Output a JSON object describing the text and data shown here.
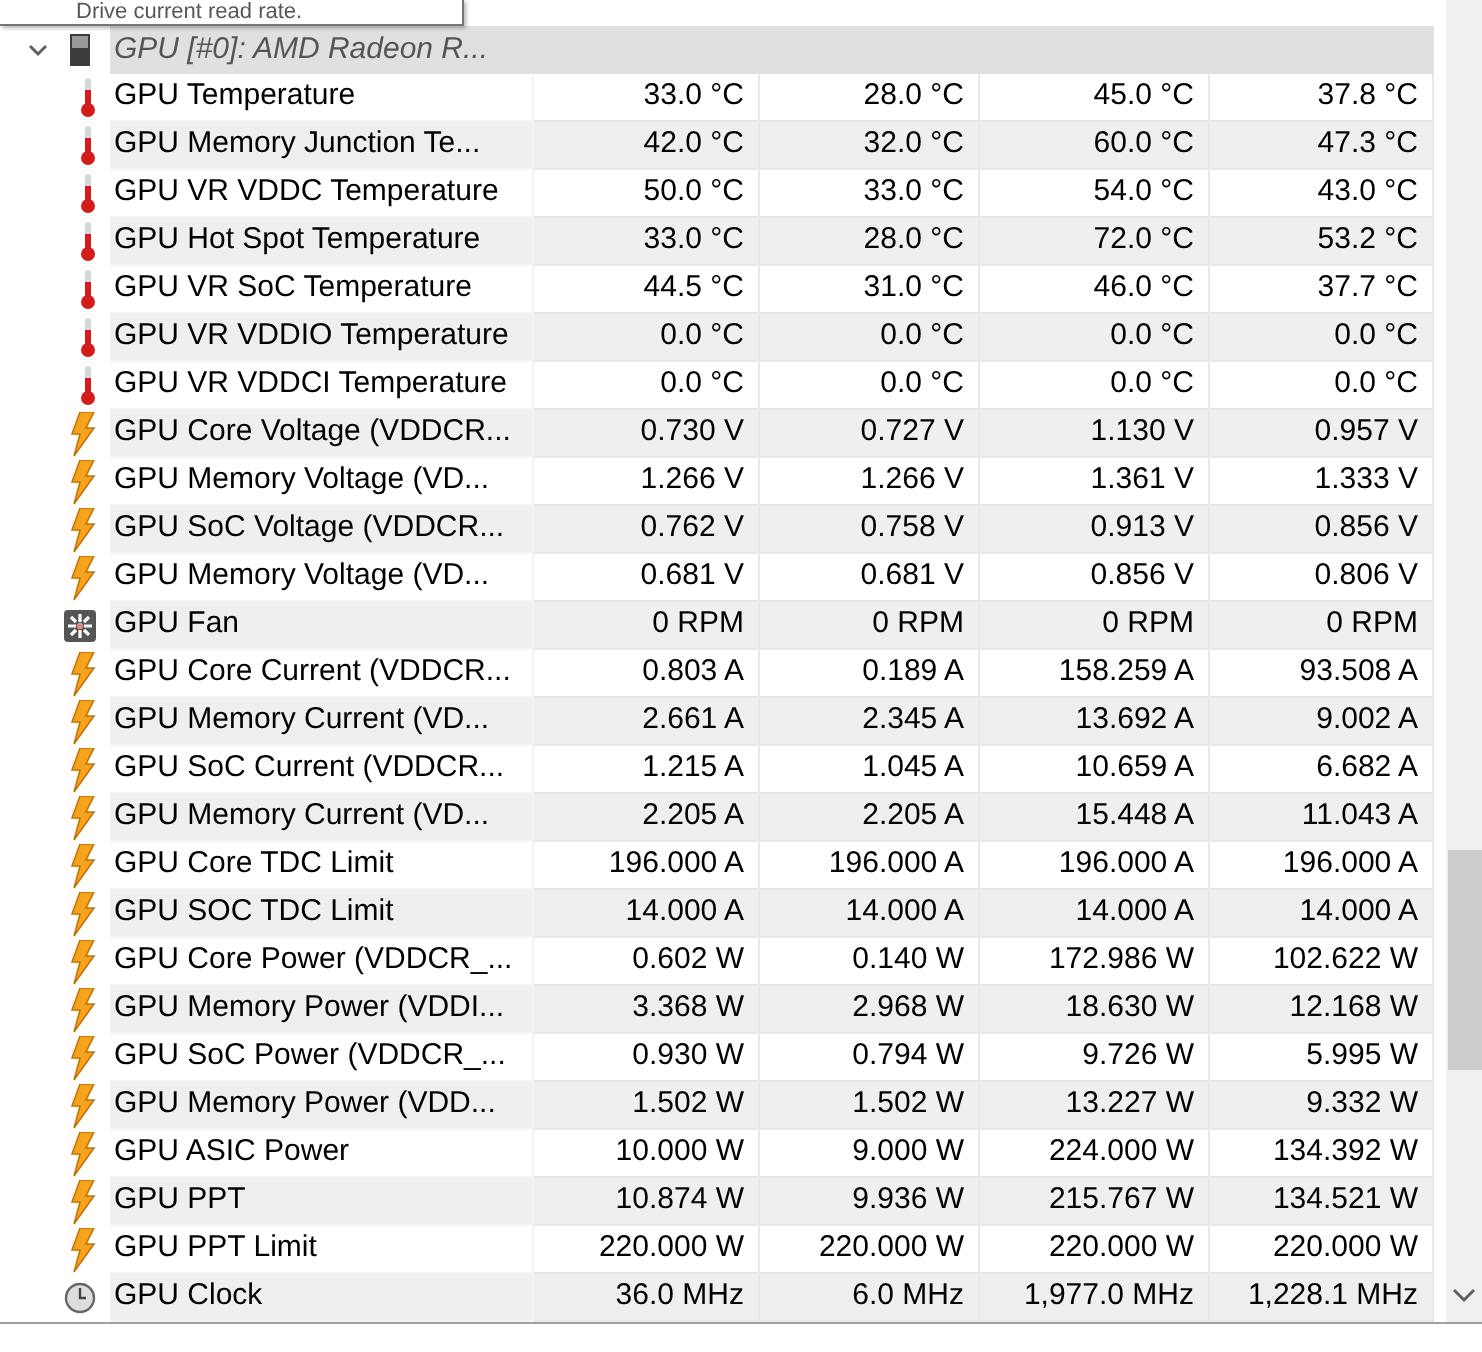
{
  "tooltip": "Drive current read rate.",
  "group": {
    "label": "GPU [#0]: AMD Radeon R...",
    "expanded": true
  },
  "rows": [
    {
      "kind": "temperature",
      "name": "GPU Temperature",
      "values": [
        "33.0 °C",
        "28.0 °C",
        "45.0 °C",
        "37.8 °C"
      ]
    },
    {
      "kind": "temperature",
      "name": "GPU Memory Junction Te...",
      "values": [
        "42.0 °C",
        "32.0 °C",
        "60.0 °C",
        "47.3 °C"
      ]
    },
    {
      "kind": "temperature",
      "name": "GPU VR VDDC Temperature",
      "values": [
        "50.0 °C",
        "33.0 °C",
        "54.0 °C",
        "43.0 °C"
      ]
    },
    {
      "kind": "temperature",
      "name": "GPU Hot Spot Temperature",
      "values": [
        "33.0 °C",
        "28.0 °C",
        "72.0 °C",
        "53.2 °C"
      ]
    },
    {
      "kind": "temperature",
      "name": "GPU VR SoC Temperature",
      "values": [
        "44.5 °C",
        "31.0 °C",
        "46.0 °C",
        "37.7 °C"
      ]
    },
    {
      "kind": "temperature",
      "name": "GPU VR VDDIO Temperature",
      "values": [
        "0.0 °C",
        "0.0 °C",
        "0.0 °C",
        "0.0 °C"
      ]
    },
    {
      "kind": "temperature",
      "name": "GPU VR VDDCI Temperature",
      "values": [
        "0.0 °C",
        "0.0 °C",
        "0.0 °C",
        "0.0 °C"
      ]
    },
    {
      "kind": "electric",
      "name": "GPU Core Voltage (VDDCR...",
      "values": [
        "0.730 V",
        "0.727 V",
        "1.130 V",
        "0.957 V"
      ]
    },
    {
      "kind": "electric",
      "name": "GPU Memory Voltage (VD...",
      "values": [
        "1.266 V",
        "1.266 V",
        "1.361 V",
        "1.333 V"
      ]
    },
    {
      "kind": "electric",
      "name": "GPU SoC Voltage (VDDCR...",
      "values": [
        "0.762 V",
        "0.758 V",
        "0.913 V",
        "0.856 V"
      ]
    },
    {
      "kind": "electric",
      "name": "GPU Memory Voltage (VD...",
      "values": [
        "0.681 V",
        "0.681 V",
        "0.856 V",
        "0.806 V"
      ]
    },
    {
      "kind": "fan",
      "name": "GPU Fan",
      "values": [
        "0 RPM",
        "0 RPM",
        "0 RPM",
        "0 RPM"
      ]
    },
    {
      "kind": "electric",
      "name": "GPU Core Current (VDDCR...",
      "values": [
        "0.803 A",
        "0.189 A",
        "158.259 A",
        "93.508 A"
      ]
    },
    {
      "kind": "electric",
      "name": "GPU Memory Current (VD...",
      "values": [
        "2.661 A",
        "2.345 A",
        "13.692 A",
        "9.002 A"
      ]
    },
    {
      "kind": "electric",
      "name": "GPU SoC Current (VDDCR...",
      "values": [
        "1.215 A",
        "1.045 A",
        "10.659 A",
        "6.682 A"
      ]
    },
    {
      "kind": "electric",
      "name": "GPU Memory Current (VD...",
      "values": [
        "2.205 A",
        "2.205 A",
        "15.448 A",
        "11.043 A"
      ]
    },
    {
      "kind": "electric",
      "name": "GPU Core TDC Limit",
      "values": [
        "196.000 A",
        "196.000 A",
        "196.000 A",
        "196.000 A"
      ]
    },
    {
      "kind": "electric",
      "name": "GPU SOC TDC Limit",
      "values": [
        "14.000 A",
        "14.000 A",
        "14.000 A",
        "14.000 A"
      ]
    },
    {
      "kind": "electric",
      "name": "GPU Core Power (VDDCR_...",
      "values": [
        "0.602 W",
        "0.140 W",
        "172.986 W",
        "102.622 W"
      ]
    },
    {
      "kind": "electric",
      "name": "GPU Memory Power (VDDI...",
      "values": [
        "3.368 W",
        "2.968 W",
        "18.630 W",
        "12.168 W"
      ]
    },
    {
      "kind": "electric",
      "name": "GPU SoC Power (VDDCR_...",
      "values": [
        "0.930 W",
        "0.794 W",
        "9.726 W",
        "5.995 W"
      ]
    },
    {
      "kind": "electric",
      "name": "GPU Memory Power (VDD...",
      "values": [
        "1.502 W",
        "1.502 W",
        "13.227 W",
        "9.332 W"
      ]
    },
    {
      "kind": "electric",
      "name": "GPU ASIC Power",
      "values": [
        "10.000 W",
        "9.000 W",
        "224.000 W",
        "134.392 W"
      ]
    },
    {
      "kind": "electric",
      "name": "GPU PPT",
      "values": [
        "10.874 W",
        "9.936 W",
        "215.767 W",
        "134.521 W"
      ]
    },
    {
      "kind": "electric",
      "name": "GPU PPT Limit",
      "values": [
        "220.000 W",
        "220.000 W",
        "220.000 W",
        "220.000 W"
      ]
    },
    {
      "kind": "clock",
      "name": "GPU Clock",
      "values": [
        "36.0 MHz",
        "6.0 MHz",
        "1,977.0 MHz",
        "1,228.1 MHz"
      ]
    }
  ]
}
